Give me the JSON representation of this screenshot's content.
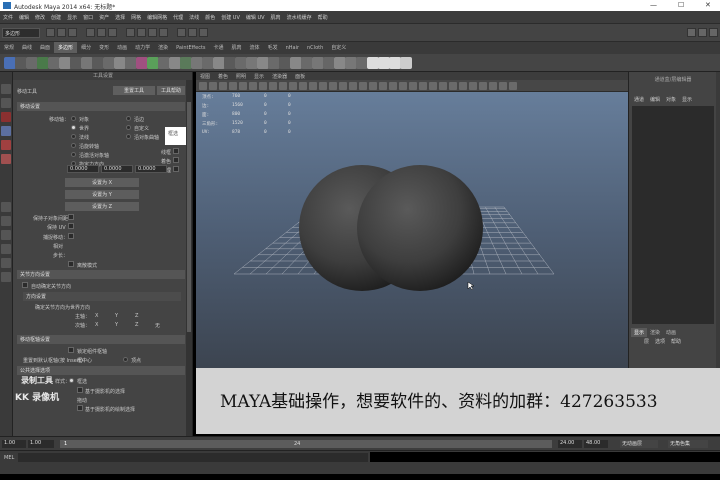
{
  "window": {
    "title": "Autodesk Maya 2014 x64: 无标题*",
    "controls": [
      "—",
      "☐",
      "✕"
    ]
  },
  "menubar": [
    "文件",
    "编辑",
    "修改",
    "创建",
    "显示",
    "窗口",
    "资产",
    "选择",
    "网格",
    "编辑网格",
    "代理",
    "法线",
    "颜色",
    "创建 UV",
    "编辑 UV",
    "肌肉",
    "流水线缓存",
    "帮助"
  ],
  "status": {
    "mode": "多边形"
  },
  "shelf": {
    "tabs": [
      "常规",
      "曲线",
      "曲面",
      "多边形",
      "细分",
      "变形",
      "动画",
      "动力学",
      "渲染",
      "PaintEffects",
      "卡通",
      "肌肉",
      "流体",
      "毛发",
      "nHair",
      "nCloth",
      "自定义"
    ],
    "active_tab": 3
  },
  "tool_settings": {
    "header": "工具设置",
    "tool_name": "移动工具",
    "reset_label": "重置工具",
    "help_label": "工具帮助",
    "section_move": "移动设置",
    "move_axis_label": "移动轴：",
    "opts": {
      "object": "对象",
      "world": "世界",
      "normal": "法线",
      "along_rot": "沿旋转轴",
      "edge": "沿边",
      "custom": "自定义",
      "live_object": "沿对象曲轴",
      "along_live": "沿激活对象轴",
      "specified": "指定力方向"
    },
    "field_values": [
      "0.0000",
      "0.0000",
      "0.0000"
    ],
    "side_checks": [
      "线框",
      "着色",
      "纹理"
    ],
    "set_buttons": [
      "设置为 X",
      "设置为 Y",
      "设置为 Z"
    ],
    "keep_spacing": "保持子对象间距",
    "preserve_uv": "保持 UV",
    "snap_move": "捕捉移动：",
    "relative": "相对",
    "step": "步长：",
    "discrete": "离散模式",
    "section_joint": "关节方向设置",
    "auto_orient": "自动确定关节方向",
    "orient": "方向设置",
    "orient_sub": "确定关节方向为世界方向",
    "primary": "主轴：",
    "secondary": "次轴：",
    "axes": [
      "X",
      "Y",
      "Z"
    ],
    "none": "无",
    "section_pivot": "移动枢轴设置",
    "pin_pivot": "锁定组件枢轴",
    "reset_pivot": "重置到默认枢轴(按 Insert)：",
    "bbox_center": "框中心",
    "vertex": "顶点",
    "section_select": "公共选择选项",
    "style": "样式：",
    "marquee": "框选",
    "camera_based": "基于摄影机的选择",
    "drag": "拖动",
    "camera_paint": "基于摄影机的绘制选择",
    "tooltip": "框选"
  },
  "viewport": {
    "menu": [
      "视图",
      "着色",
      "照明",
      "显示",
      "渲染器",
      "面板"
    ],
    "hud": [
      {
        "label": "顶点:",
        "value": "760",
        "a": "0",
        "b": "0"
      },
      {
        "label": "边:",
        "value": "1560",
        "a": "0",
        "b": "0"
      },
      {
        "label": "面:",
        "value": "800",
        "a": "0",
        "b": "0"
      },
      {
        "label": "三角形:",
        "value": "1520",
        "a": "0",
        "b": "0"
      },
      {
        "label": "UV:",
        "value": "878",
        "a": "0",
        "b": "0"
      }
    ]
  },
  "caption": "MAYA基础操作，想要软件的、资料的加群：427263533",
  "right_panel": {
    "title": "通道盒/层编辑器",
    "menu": [
      "通道",
      "编辑",
      "对象",
      "显示"
    ],
    "tabs": [
      "显示",
      "渲染",
      "动画"
    ],
    "sub_menu": [
      "层",
      "选项",
      "帮助"
    ]
  },
  "watermark": {
    "line1": "录制工具",
    "line2": "KK 录像机"
  },
  "time": {
    "start": "1.00",
    "current": "1.00",
    "frame_marker": "1",
    "frame_24": "24",
    "end": "24.00",
    "range_end": "48.00",
    "anim_layer": "无动画层",
    "char_set": "无角色集"
  },
  "command": {
    "label": "MEL"
  }
}
